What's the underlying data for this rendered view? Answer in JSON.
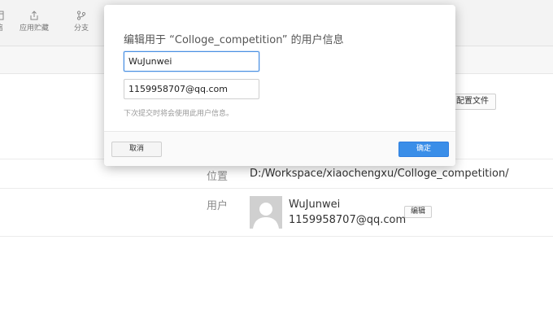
{
  "toolbar": {
    "items": [
      {
        "label": "缩",
        "icon": "window-icon"
      },
      {
        "label": "应用贮藏",
        "icon": "upload-icon"
      },
      {
        "label": "分支",
        "icon": "branch-icon"
      }
    ]
  },
  "main": {
    "config_button_label": "配置文件",
    "location_label": "位置",
    "location_value": "D:/Workspace/xiaochengxu/Colloge_competition/",
    "user_label": "用户",
    "user_name": "WuJunwei",
    "user_email": "1159958707@qq.com",
    "edit_button_label": "编辑"
  },
  "dialog": {
    "title": "编辑用于 “Colloge_competition” 的用户信息",
    "name_value": "WuJunwei",
    "email_value": "1159958707@qq.com",
    "hint": "下次提交时将会使用此用户信息。",
    "cancel_label": "取消",
    "confirm_label": "确定"
  },
  "colors": {
    "accent": "#3a8ee8",
    "toolbar_bg": "#f3f3f3"
  }
}
